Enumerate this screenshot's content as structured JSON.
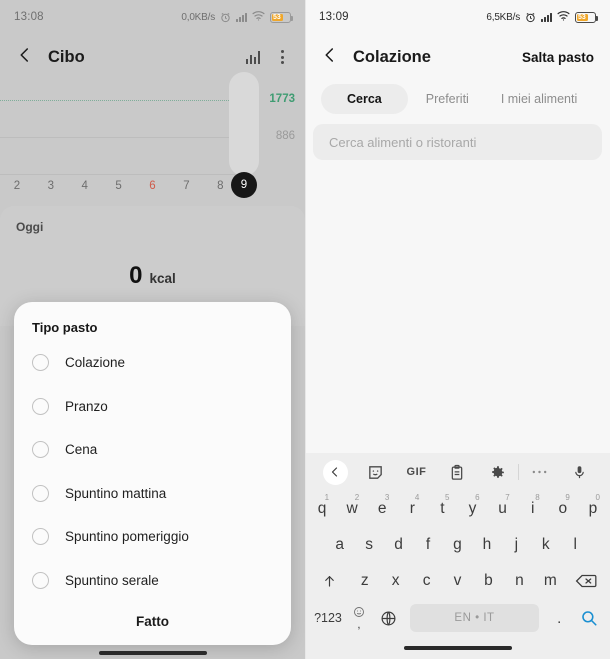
{
  "left": {
    "status": {
      "time": "13:08",
      "network_speed": "0,0KB/s",
      "battery_level": "53"
    },
    "appbar": {
      "title": "Cibo",
      "back_icon": "back-chevron-icon",
      "stats_icon": "bar-chart-icon",
      "menu_icon": "kebab-menu-icon"
    },
    "chart_data": {
      "type": "bar",
      "title": "Cibo",
      "categories": [
        "2",
        "3",
        "4",
        "5",
        "6",
        "7",
        "8",
        "9"
      ],
      "values": [
        0,
        0,
        0,
        0,
        0,
        0,
        0,
        0
      ],
      "xlabel": "",
      "ylabel": "kcal",
      "goal_line": 1773,
      "goal_line_label": "1773",
      "average_line": 886,
      "average_line_label": "886",
      "selected_category": "9",
      "highlighted_category": "6",
      "grid": true,
      "legend": "none",
      "goal_color": "#3f9c72",
      "average_color": "#9a9a9a"
    },
    "today": {
      "label": "Oggi",
      "kcal_value": "0",
      "kcal_unit": "kcal"
    },
    "dialog": {
      "title": "Tipo pasto",
      "options": [
        {
          "label": "Colazione",
          "selected": false
        },
        {
          "label": "Pranzo",
          "selected": false
        },
        {
          "label": "Cena",
          "selected": false
        },
        {
          "label": "Spuntino mattina",
          "selected": false
        },
        {
          "label": "Spuntino pomeriggio",
          "selected": false
        },
        {
          "label": "Spuntino serale",
          "selected": false
        }
      ],
      "done_label": "Fatto"
    }
  },
  "right": {
    "status": {
      "time": "13:09",
      "network_speed": "6,5KB/s",
      "battery_level": "53"
    },
    "appbar": {
      "title": "Colazione",
      "back_icon": "back-chevron-icon",
      "skip_label": "Salta pasto"
    },
    "tabs": [
      {
        "label": "Cerca",
        "active": true
      },
      {
        "label": "Preferiti",
        "active": false
      },
      {
        "label": "I miei alimenti",
        "active": false
      }
    ],
    "search": {
      "placeholder": "Cerca alimenti o ristoranti",
      "value": ""
    },
    "keyboard": {
      "toolbar": [
        "back-chevron-icon",
        "sticker-icon",
        "GIF",
        "clipboard-icon",
        "gear-icon",
        "overflow-dots-icon",
        "microphone-icon"
      ],
      "gif_label": "GIF",
      "row1": [
        {
          "key": "q",
          "num": "1"
        },
        {
          "key": "w",
          "num": "2"
        },
        {
          "key": "e",
          "num": "3"
        },
        {
          "key": "r",
          "num": "4"
        },
        {
          "key": "t",
          "num": "5"
        },
        {
          "key": "y",
          "num": "6"
        },
        {
          "key": "u",
          "num": "7"
        },
        {
          "key": "i",
          "num": "8"
        },
        {
          "key": "o",
          "num": "9"
        },
        {
          "key": "p",
          "num": "0"
        }
      ],
      "row2": [
        "a",
        "s",
        "d",
        "f",
        "g",
        "h",
        "j",
        "k",
        "l"
      ],
      "row3": [
        "z",
        "x",
        "c",
        "v",
        "b",
        "n",
        "m"
      ],
      "shift_icon": "shift-arrow-icon",
      "backspace_icon": "backspace-icon",
      "symbols_label": "?123",
      "comma_label": ",",
      "emoji_icon": "emoji-icon",
      "globe_icon": "globe-icon",
      "spacebar_label": "EN • IT",
      "period_label": ".",
      "search_icon": "search-icon",
      "search_icon_color": "#1a8fd1"
    }
  }
}
